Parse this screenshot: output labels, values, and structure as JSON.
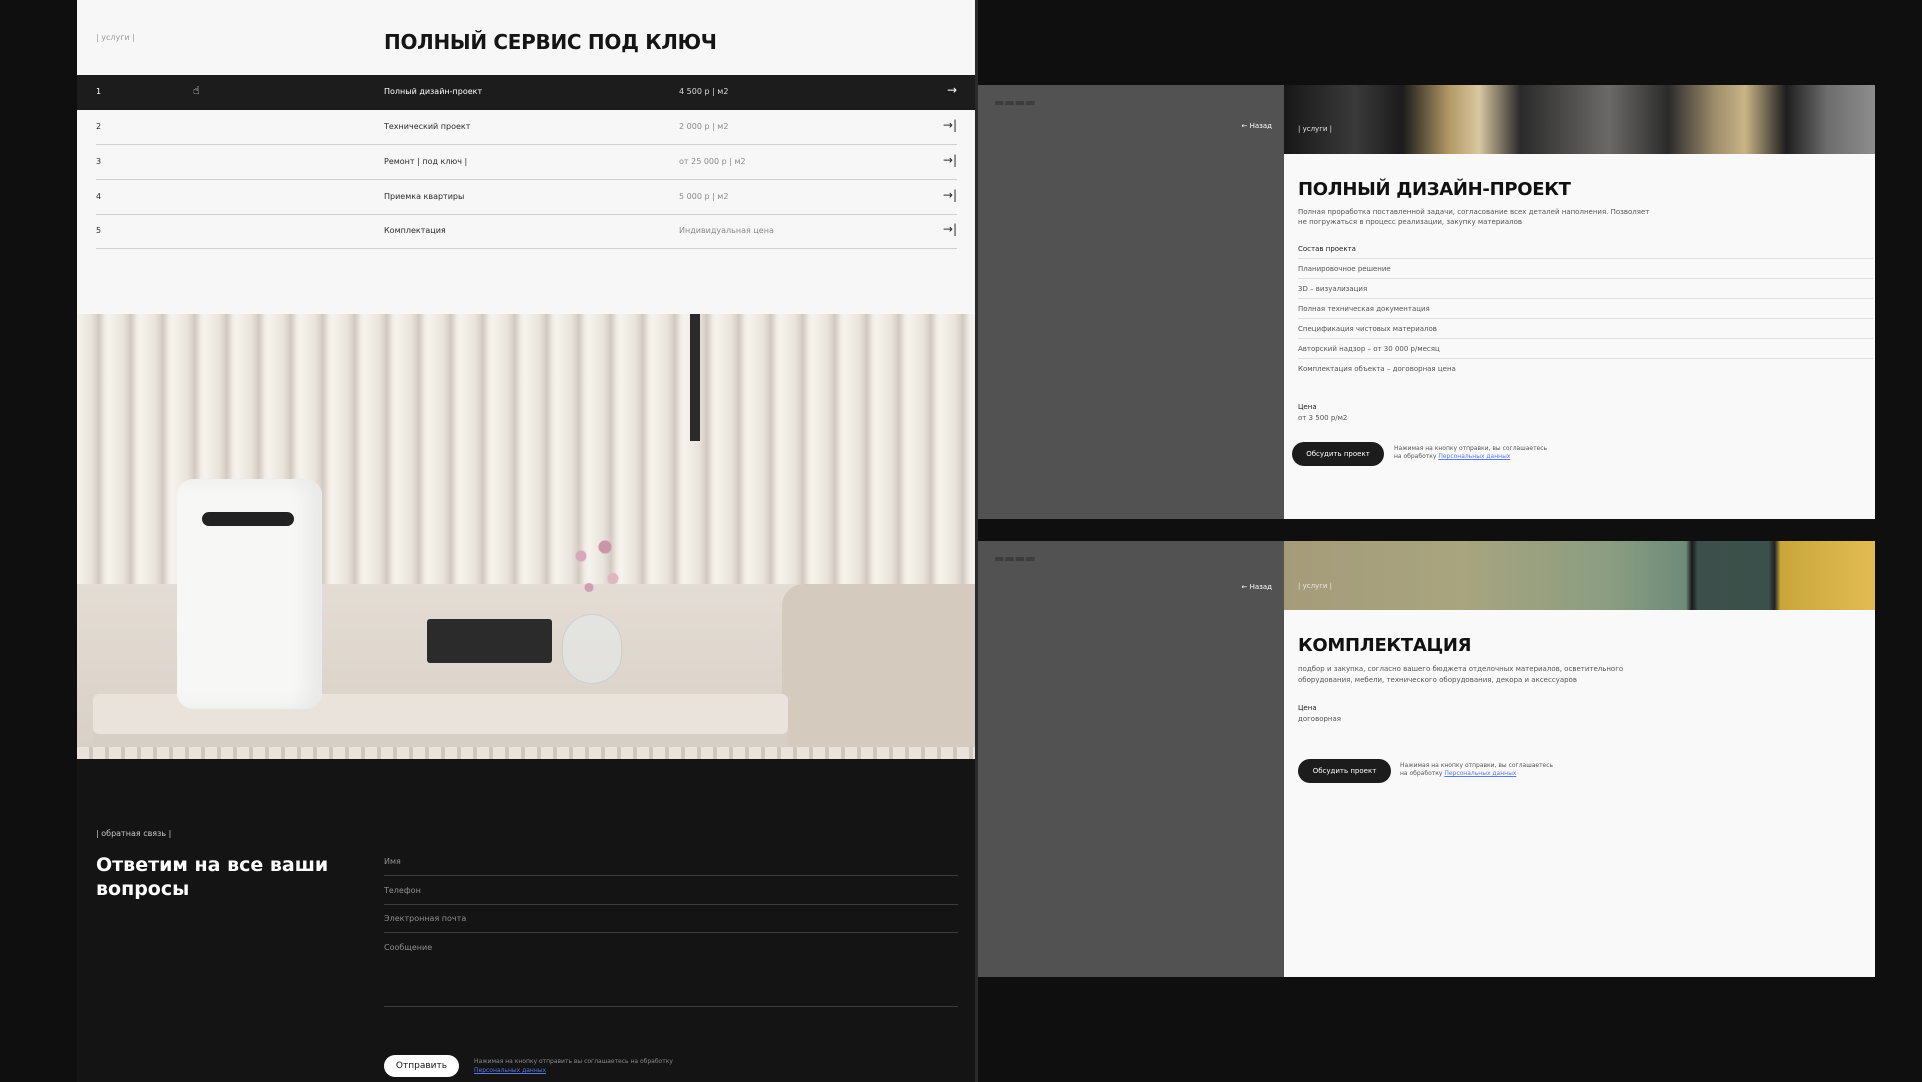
{
  "left": {
    "tag": "| услуги |",
    "title": "ПОЛНЫЙ СЕРВИС ПОД КЛЮЧ",
    "services": [
      {
        "num": "1",
        "name": "Полный дизайн-проект",
        "price": "4 500 р | м2",
        "arrow": "→"
      },
      {
        "num": "2",
        "name": "Технический проект",
        "price": "2 000 р | м2",
        "arrow": "→|"
      },
      {
        "num": "3",
        "name": "Ремонт | под ключ |",
        "price": "от 25 000 р | м2",
        "arrow": "→|"
      },
      {
        "num": "4",
        "name": "Приемка квартиры",
        "price": "5 000 р | м2",
        "arrow": "→|"
      },
      {
        "num": "5",
        "name": "Комплектация",
        "price": "Индивидуальная цена",
        "arrow": "→|"
      }
    ],
    "feedback": {
      "tag": "| обратная связь |",
      "title": "Ответим на все ваши вопросы",
      "fields": [
        "Имя",
        "Телефон",
        "Электронная почта",
        "Сообщение"
      ],
      "send": "Отправить",
      "consent": "Нажимая на кнопку отправить вы соглашаетесь на обработку",
      "consent_link": "Персональных данных"
    }
  },
  "design_card": {
    "back": "← Назад",
    "tag": "| услуги |",
    "title": "ПОЛНЫЙ ДИЗАЙН-ПРОЕКТ",
    "desc_1": "Полная проработка поставленной задачи, согласование всех деталей наполнения. Позволяет",
    "desc_2": "не погружаться в процесс реализации, закупку материалов",
    "composition_title": "Состав проекта",
    "items": [
      "Планировочное решение",
      "3D – визуализация",
      "Полная техническая документация",
      "Спецификация чистовых материалов",
      "Авторский надзор – от 30 000 р/месяц",
      "Комплектация объекта – договорная цена"
    ],
    "price_label": "Цена",
    "price": "от 3 500 р/м2",
    "button": "Обсудить проект",
    "consent_1": "Нажимая на кнопку отправки, вы соглашаетесь",
    "consent_2": "на обработку",
    "consent_link": "Персональных данных"
  },
  "kit_card": {
    "back": "← Назад",
    "tag": "| услуги |",
    "title": "КОМПЛЕКТАЦИЯ",
    "desc_1": "подбор и закупка, согласно вашего бюджета отделочных материалов, осветительного",
    "desc_2": "оборудования, мебели, технического оборудования, декора и аксессуаров",
    "price_label": "Цена",
    "price": "договорная",
    "button": "Обсудить проект",
    "consent_1": "Нажимая на кнопку отправки, вы соглашаетесь",
    "consent_2": "на обработку",
    "consent_link": "Персональных данных"
  },
  "colors": {
    "accent_dark": "#1c1c1c",
    "link": "#5b78e0",
    "overlay": "#525252"
  }
}
